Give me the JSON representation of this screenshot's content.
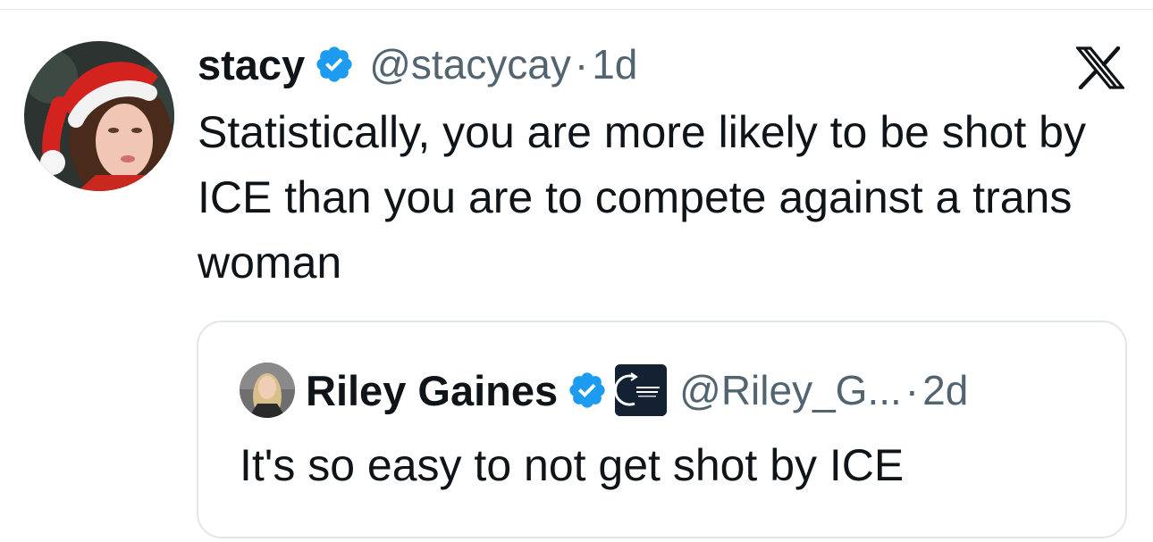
{
  "tweet": {
    "author": {
      "display_name": "stacy",
      "handle": "@stacycay",
      "verified": true
    },
    "separator": "·",
    "timestamp": "1d",
    "text": "Statistically, you are more likely to be shot by ICE than you are to compete against a trans woman",
    "platform_icon": "x-logo-icon"
  },
  "quoted_tweet": {
    "author": {
      "display_name": "Riley Gaines",
      "handle": "@Riley_G...",
      "verified": true,
      "affiliate_badge": "affiliate-badge-icon"
    },
    "separator": "·",
    "timestamp": "2d",
    "text": "It's so easy to not get shot by ICE"
  },
  "colors": {
    "primary_text": "#0f1419",
    "secondary_text": "#536471",
    "verified_blue": "#1d9bf0",
    "border": "#e1e6ea"
  }
}
